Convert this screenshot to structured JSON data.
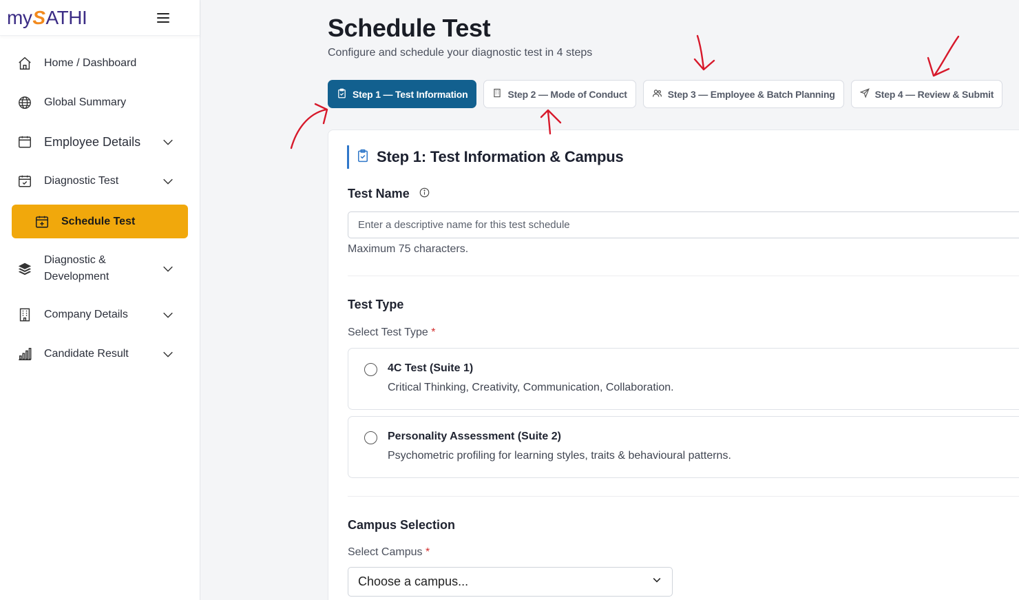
{
  "brand": {
    "my": "my",
    "s": "S",
    "rest": "ATHI"
  },
  "sidebar": {
    "items": [
      {
        "label": "Home / Dashboard",
        "icon": "home-icon",
        "has_chevron": false
      },
      {
        "label": "Global Summary",
        "icon": "globe-icon",
        "has_chevron": false
      },
      {
        "label": "Employee Details",
        "icon": "calendar-icon",
        "has_chevron": true
      },
      {
        "label": "Diagnostic Test",
        "icon": "calendar-check-icon",
        "has_chevron": true
      },
      {
        "label": "Schedule Test",
        "icon": "calendar-plus-icon",
        "active": true
      },
      {
        "label_line1": "Diagnostic &",
        "label_line2": "Development",
        "icon": "layers-icon",
        "has_chevron": true
      },
      {
        "label": "Company Details",
        "icon": "building-icon",
        "has_chevron": true
      },
      {
        "label": "Candidate Result",
        "icon": "bar-chart-icon",
        "has_chevron": true
      }
    ],
    "active_color": "#f1a80c"
  },
  "page": {
    "title": "Schedule Test",
    "subtitle": "Configure and schedule your diagnostic test in 4 steps"
  },
  "steps": [
    {
      "label": "Step 1 — Test Information",
      "icon": "clipboard-icon",
      "active": true
    },
    {
      "label": "Step 2 — Mode of Conduct",
      "icon": "building-icon",
      "active": false
    },
    {
      "label": "Step 3 — Employee & Batch Planning",
      "icon": "users-icon",
      "active": false
    },
    {
      "label": "Step 4 — Review & Submit",
      "icon": "send-icon",
      "active": false
    }
  ],
  "accent_color": "#12608f",
  "form": {
    "section_title": "Step 1: Test Information & Campus",
    "test_name": {
      "label": "Test Name",
      "placeholder": "Enter a descriptive name for this test schedule",
      "value": "",
      "hint": "Maximum 75 characters."
    },
    "test_type": {
      "heading": "Test Type",
      "label": "Select Test Type",
      "required_mark": "*",
      "options": [
        {
          "title": "4C Test (Suite 1)",
          "desc": "Critical Thinking, Creativity, Communication, Collaboration."
        },
        {
          "title": "Personality Assessment (Suite 2)",
          "desc": "Psychometric profiling for learning styles, traits & behavioural patterns."
        }
      ]
    },
    "campus": {
      "heading": "Campus Selection",
      "label": "Select Campus",
      "required_mark": "*",
      "selected": "Choose a campus..."
    }
  }
}
